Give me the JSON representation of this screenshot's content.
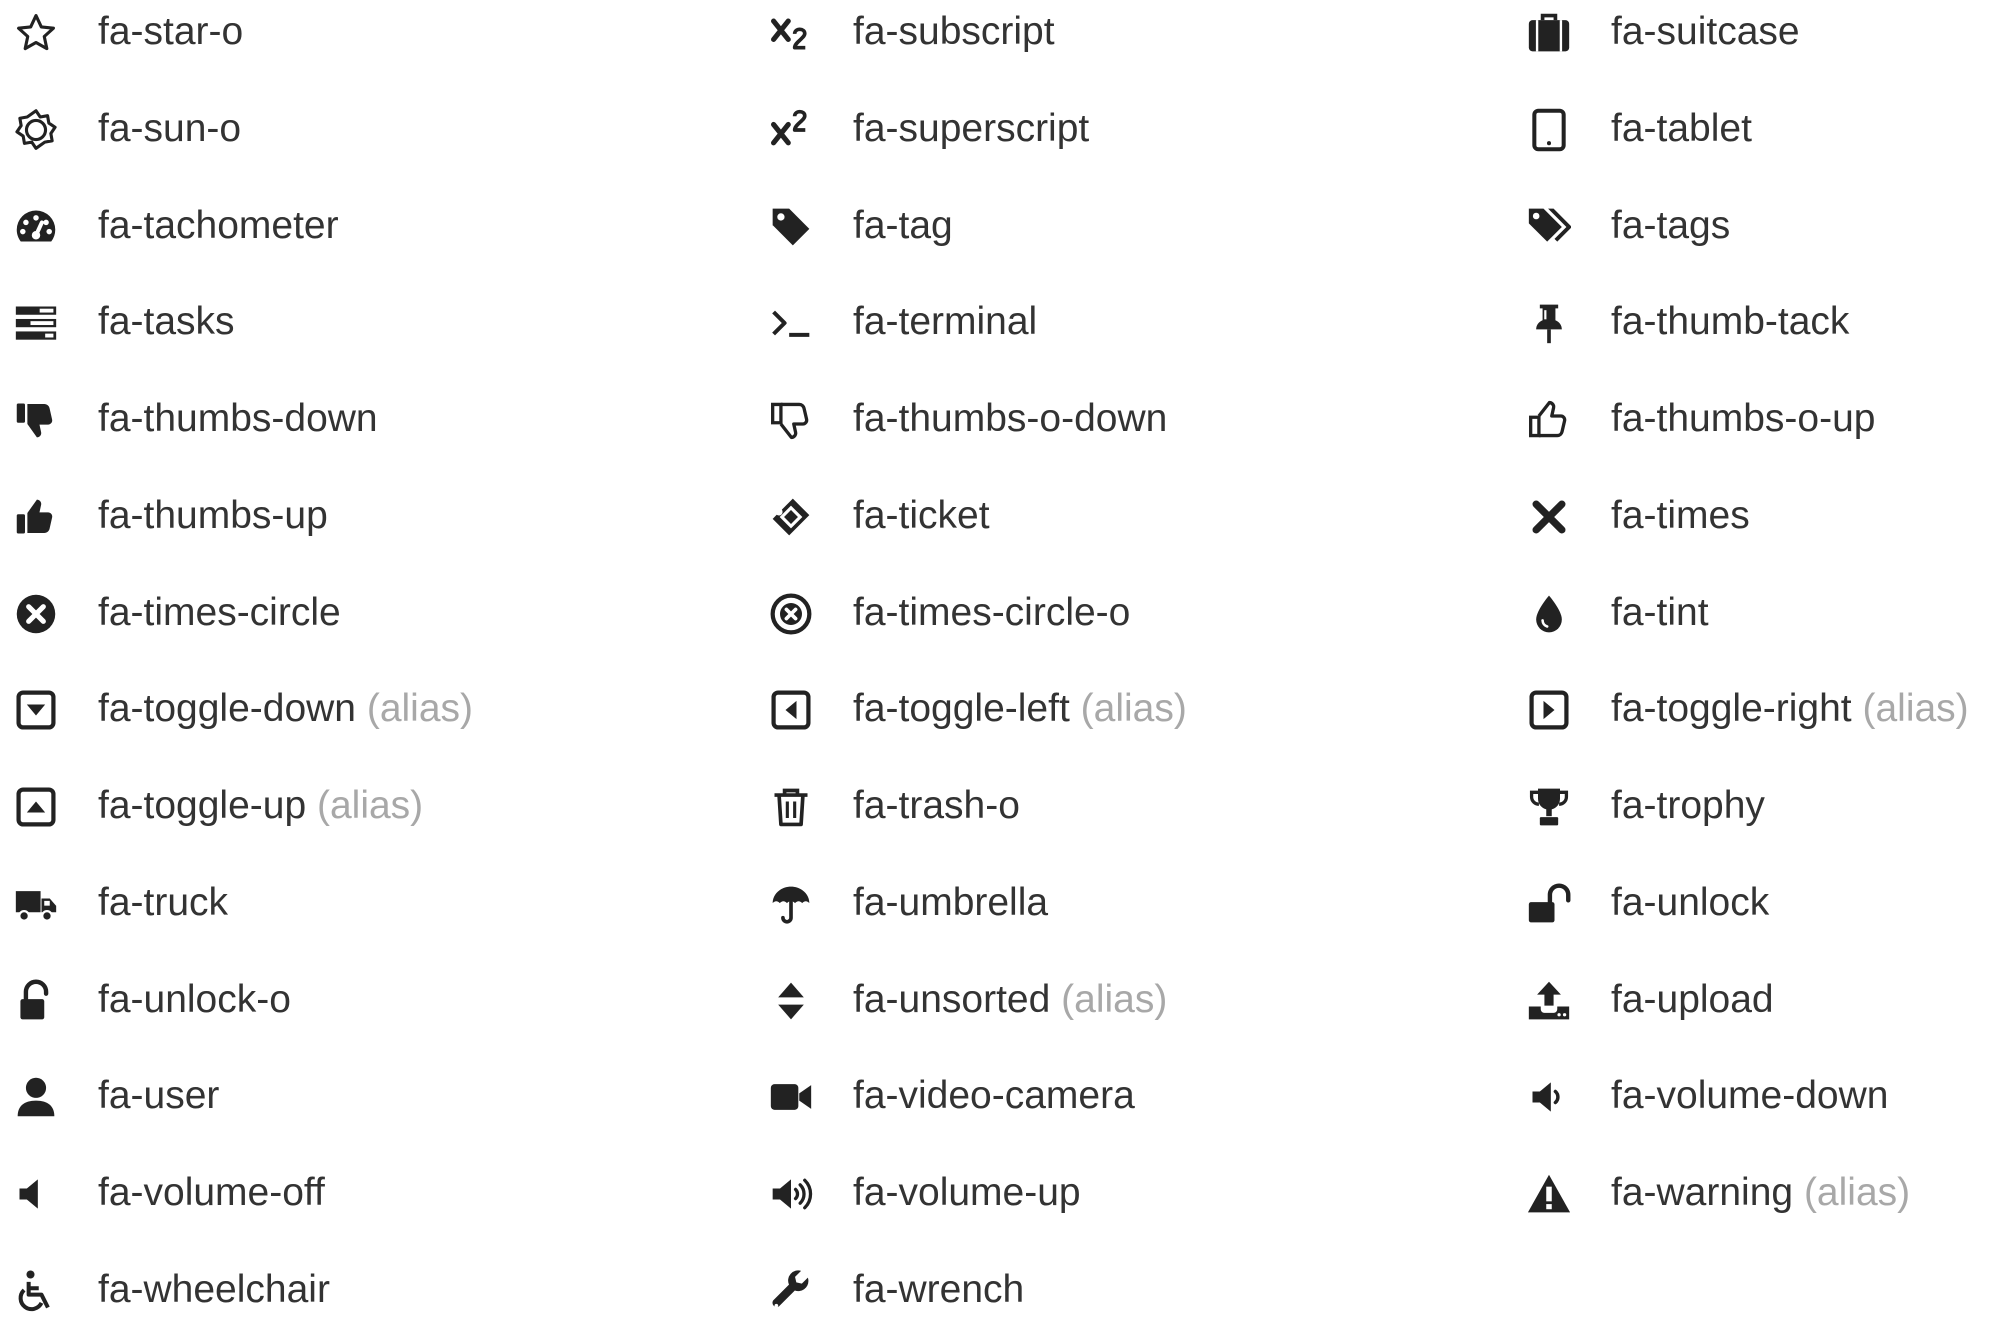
{
  "alias_label": "(alias)",
  "columns": [
    [
      {
        "name": "fa-star-o",
        "icon": "star-outline-icon"
      },
      {
        "name": "fa-sun-o",
        "icon": "sun-outline-icon"
      },
      {
        "name": "fa-tachometer",
        "icon": "tachometer-icon"
      },
      {
        "name": "fa-tasks",
        "icon": "tasks-icon"
      },
      {
        "name": "fa-thumbs-down",
        "icon": "thumbs-down-icon"
      },
      {
        "name": "fa-thumbs-up",
        "icon": "thumbs-up-icon"
      },
      {
        "name": "fa-times-circle",
        "icon": "times-circle-icon"
      },
      {
        "name": "fa-toggle-down",
        "alias": true,
        "icon": "toggle-down-icon"
      },
      {
        "name": "fa-toggle-up",
        "alias": true,
        "icon": "toggle-up-icon"
      },
      {
        "name": "fa-truck",
        "icon": "truck-icon"
      },
      {
        "name": "fa-unlock-o",
        "icon": "unlock-outline-icon"
      },
      {
        "name": "fa-user",
        "icon": "user-icon"
      },
      {
        "name": "fa-volume-off",
        "icon": "volume-off-icon"
      },
      {
        "name": "fa-wheelchair",
        "icon": "wheelchair-icon"
      }
    ],
    [
      {
        "name": "fa-subscript",
        "icon": "subscript-icon"
      },
      {
        "name": "fa-superscript",
        "icon": "superscript-icon"
      },
      {
        "name": "fa-tag",
        "icon": "tag-icon"
      },
      {
        "name": "fa-terminal",
        "icon": "terminal-icon"
      },
      {
        "name": "fa-thumbs-o-down",
        "icon": "thumbs-outline-down-icon"
      },
      {
        "name": "fa-ticket",
        "icon": "ticket-icon"
      },
      {
        "name": "fa-times-circle-o",
        "icon": "times-circle-outline-icon"
      },
      {
        "name": "fa-toggle-left",
        "alias": true,
        "icon": "toggle-left-icon"
      },
      {
        "name": "fa-trash-o",
        "icon": "trash-outline-icon"
      },
      {
        "name": "fa-umbrella",
        "icon": "umbrella-icon"
      },
      {
        "name": "fa-unsorted",
        "alias": true,
        "icon": "unsorted-icon"
      },
      {
        "name": "fa-video-camera",
        "icon": "video-camera-icon"
      },
      {
        "name": "fa-volume-up",
        "icon": "volume-up-icon"
      },
      {
        "name": "fa-wrench",
        "icon": "wrench-icon"
      }
    ],
    [
      {
        "name": "fa-suitcase",
        "icon": "suitcase-icon"
      },
      {
        "name": "fa-tablet",
        "icon": "tablet-icon"
      },
      {
        "name": "fa-tags",
        "icon": "tags-icon"
      },
      {
        "name": "fa-thumb-tack",
        "icon": "thumb-tack-icon"
      },
      {
        "name": "fa-thumbs-o-up",
        "icon": "thumbs-outline-up-icon"
      },
      {
        "name": "fa-times",
        "icon": "times-icon"
      },
      {
        "name": "fa-tint",
        "icon": "tint-icon"
      },
      {
        "name": "fa-toggle-right",
        "alias": true,
        "icon": "toggle-right-icon"
      },
      {
        "name": "fa-trophy",
        "icon": "trophy-icon"
      },
      {
        "name": "fa-unlock",
        "icon": "unlock-icon"
      },
      {
        "name": "fa-upload",
        "icon": "upload-icon"
      },
      {
        "name": "fa-volume-down",
        "icon": "volume-down-icon"
      },
      {
        "name": "fa-warning",
        "alias": true,
        "icon": "warning-icon"
      }
    ]
  ]
}
